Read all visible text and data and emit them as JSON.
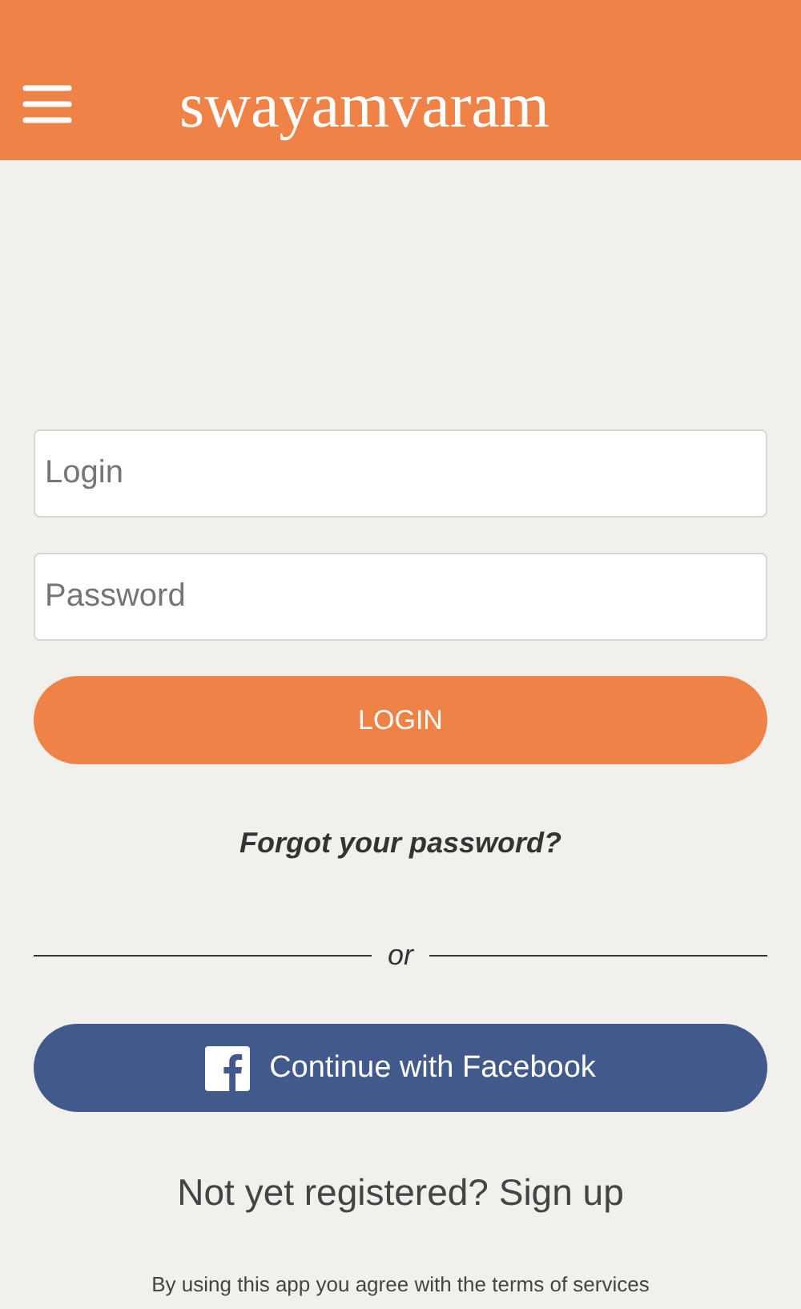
{
  "header": {
    "title": "swayamvaram"
  },
  "form": {
    "login_placeholder": "Login",
    "password_placeholder": "Password",
    "login_button": "LOGIN",
    "forgot_link": "Forgot your password?"
  },
  "divider": "or",
  "facebook_button": "Continue with Facebook",
  "signup_link": "Not yet registered? Sign up",
  "terms": "By using this app you agree with the terms of services"
}
